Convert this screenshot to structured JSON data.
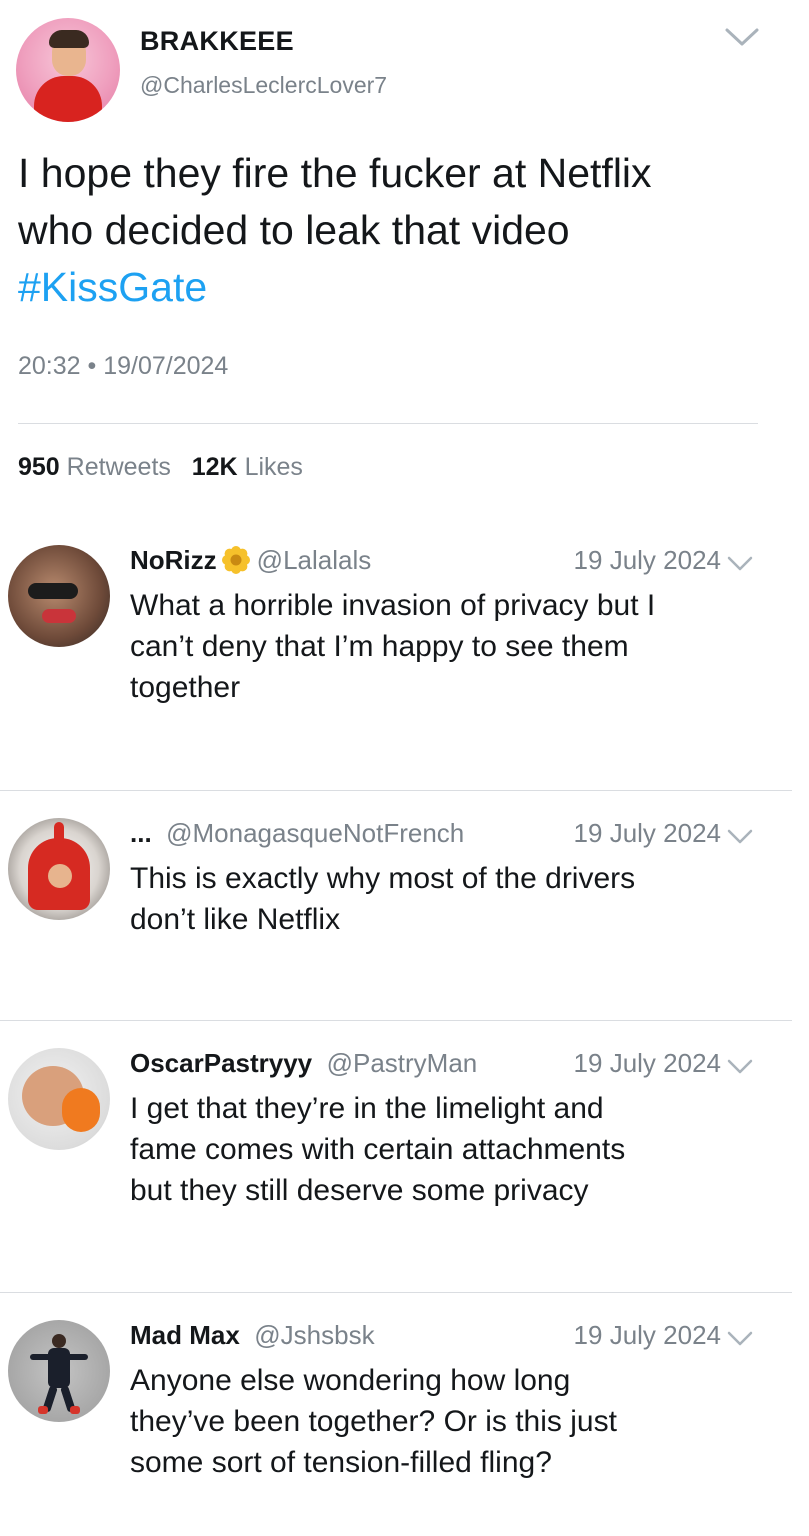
{
  "main_tweet": {
    "display_name": "BRAKKEEE",
    "handle": "@CharlesLeclercLover7",
    "text_lines": [
      "I hope they fire the fucker at Netflix",
      "who decided to leak that video"
    ],
    "hashtag": "#KissGate",
    "timestamp": "20:32 • 19/07/2024",
    "stats": {
      "retweets_count": "950",
      "retweets_label": "Retweets",
      "likes_count": "12K",
      "likes_label": "Likes"
    },
    "menu_icon": "chevron-down-icon"
  },
  "replies": [
    {
      "name": "NoRizz",
      "badge_icon": "flower-emoji-icon",
      "handle": "@Lalalals",
      "date": "19 July 2024",
      "text_lines": [
        "What a horrible invasion of privacy but I",
        "can’t deny that I’m happy to see them",
        "together"
      ]
    },
    {
      "name": "...",
      "handle": "@MonagasqueNotFrench",
      "date": "19 July 2024",
      "text_lines": [
        "This is exactly why most of the drivers",
        "don’t like Netflix"
      ]
    },
    {
      "name": "OscarPastryyy",
      "handle": "@PastryMan",
      "date": "19 July 2024",
      "text_lines": [
        "I get that they’re in the limelight and",
        "fame comes with certain attachments",
        "but they still deserve some privacy"
      ]
    },
    {
      "name": "Mad Max",
      "handle": "@Jshsbsk",
      "date": "19 July 2024",
      "text_lines": [
        "Anyone else wondering how long",
        "they’ve been together? Or is this just",
        "some sort of tension-filled fling?"
      ]
    }
  ],
  "colors": {
    "text": "#14171a",
    "secondary": "#7a828a",
    "link": "#1da1f2",
    "divider": "#dadde1"
  }
}
